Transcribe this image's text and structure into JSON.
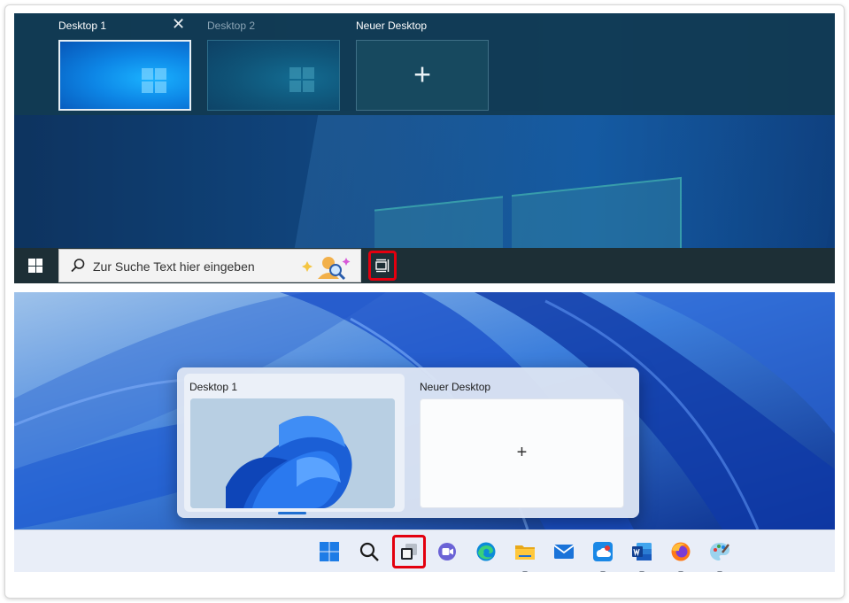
{
  "win10": {
    "desktops": [
      {
        "label": "Desktop 1",
        "selected": true
      },
      {
        "label": "Desktop 2",
        "selected": false
      }
    ],
    "new_desktop_label": "Neuer Desktop",
    "close_glyph": "✕",
    "plus_glyph": "+",
    "search_placeholder": "Zur Suche Text hier eingeben",
    "highlight_color": "#e3000f"
  },
  "win11": {
    "desktop_label": "Desktop 1",
    "new_desktop_label": "Neuer Desktop",
    "plus_glyph": "+",
    "taskbar_icons": [
      "start-icon",
      "search-icon",
      "task-view-icon",
      "teams-chat-icon",
      "edge-icon",
      "file-explorer-icon",
      "mail-icon",
      "onedrive-app-icon",
      "word-icon",
      "firefox-icon",
      "paint-icon"
    ],
    "accent_color": "#1f6fd1",
    "highlight_color": "#e3000f"
  }
}
